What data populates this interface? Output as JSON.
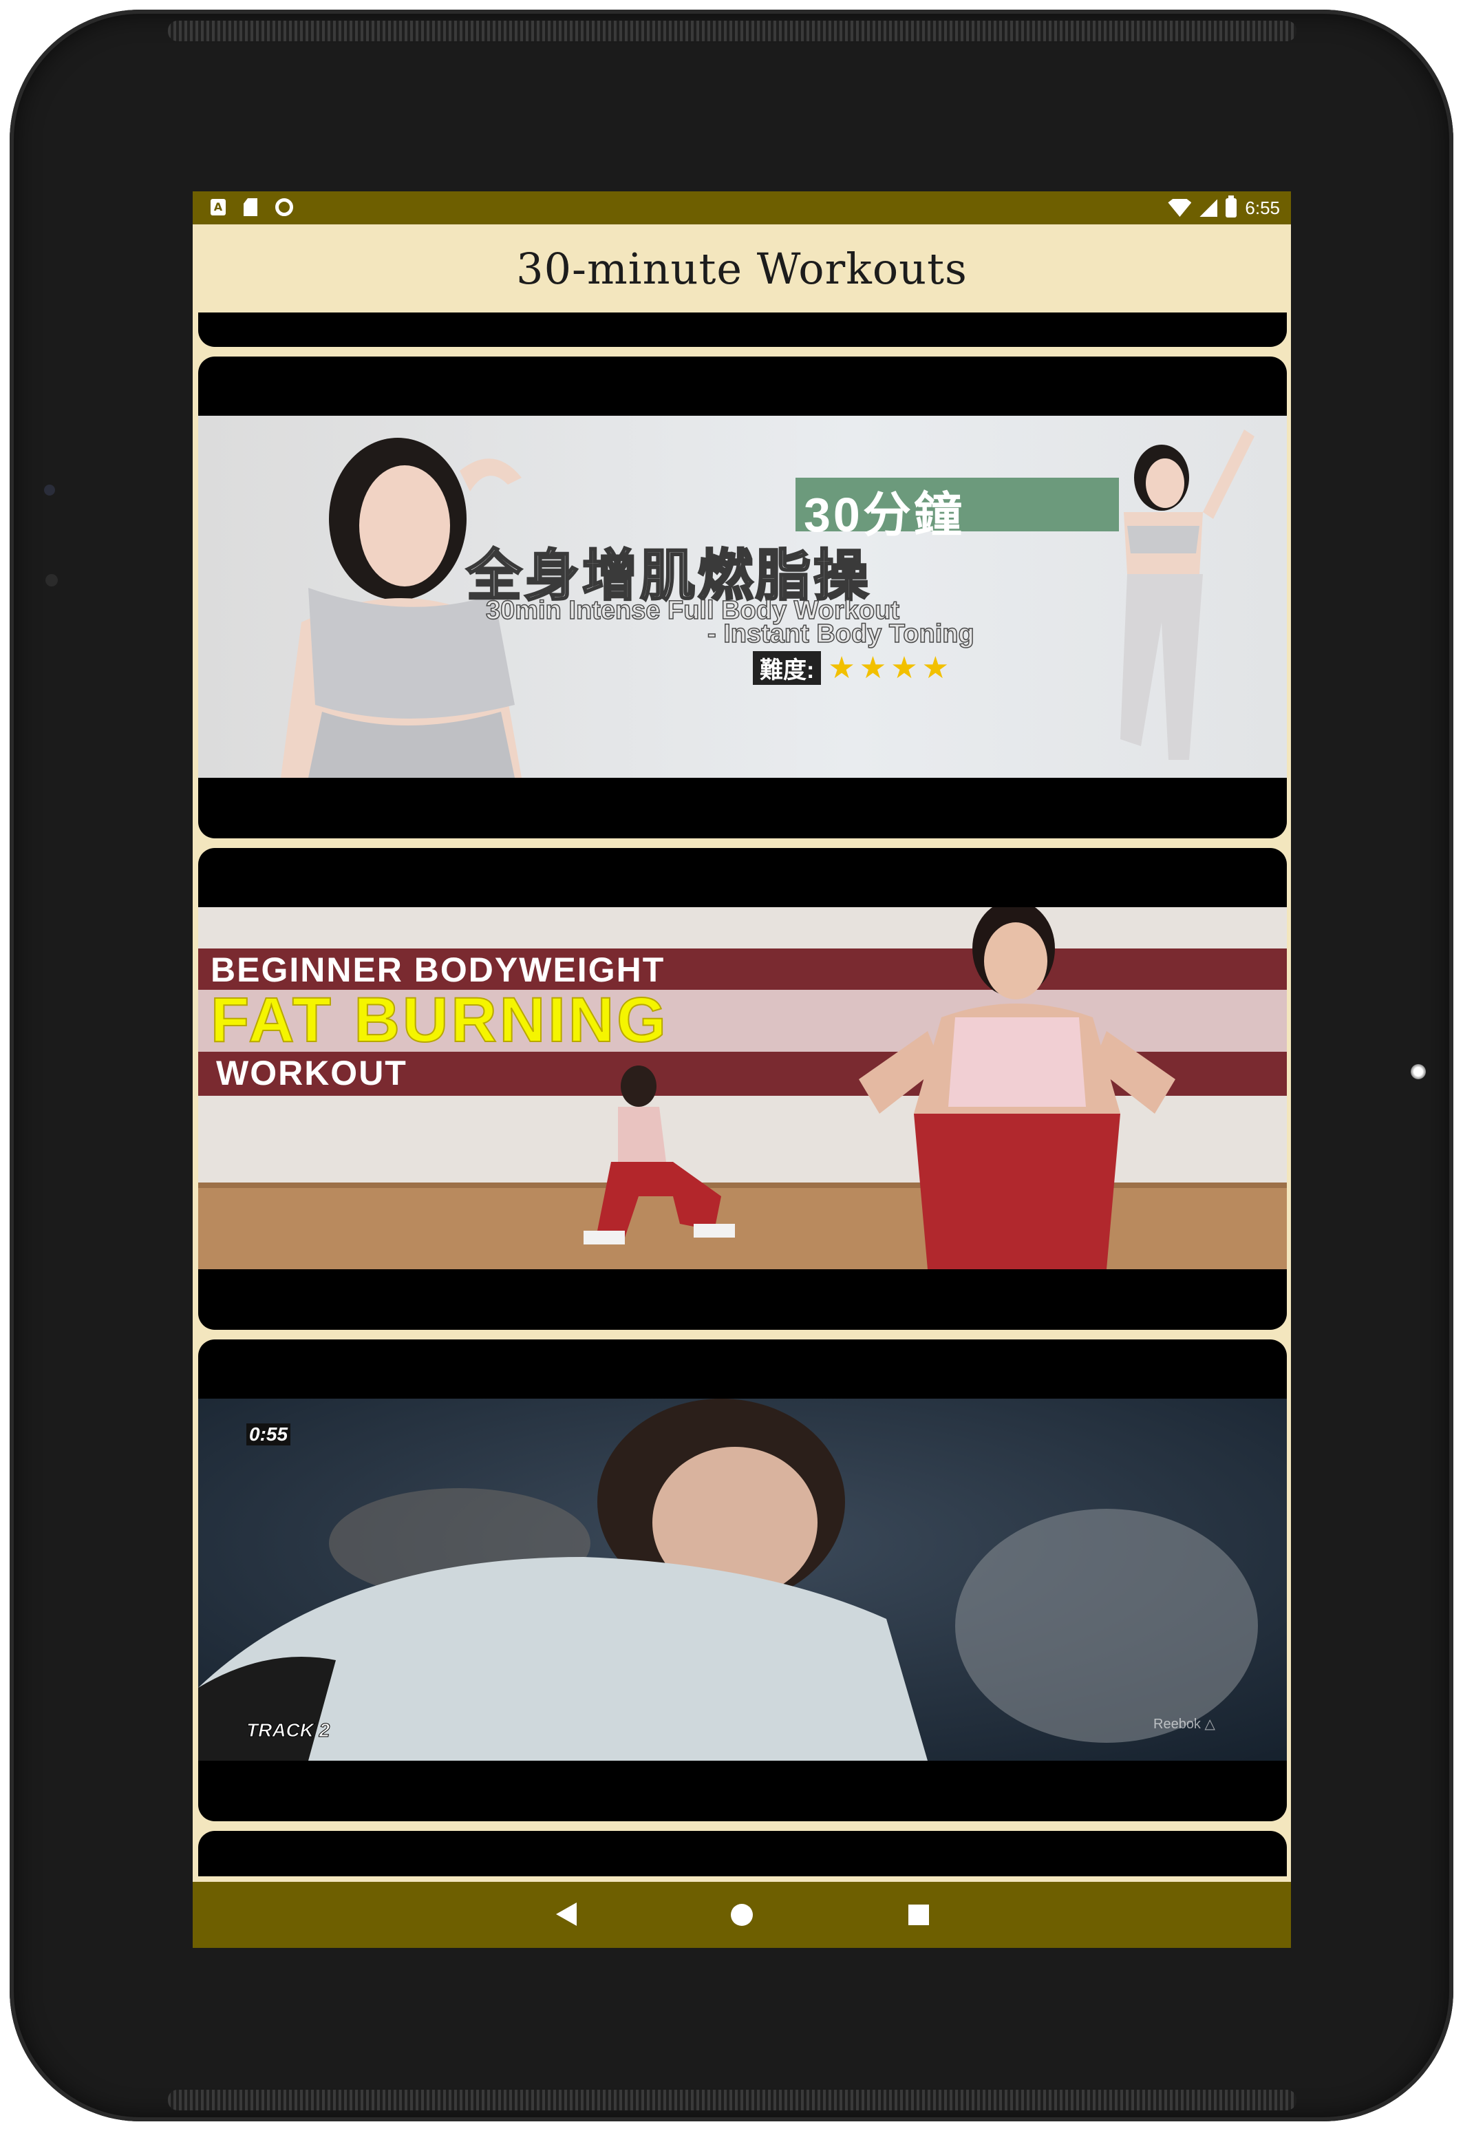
{
  "status_bar": {
    "time": "6:55",
    "left_icons": [
      "a-icon",
      "sd-card-icon",
      "sync-circle-icon"
    ],
    "right_icons": [
      "wifi-icon",
      "signal-icon",
      "battery-icon"
    ]
  },
  "app_bar": {
    "title": "30-minute Workouts"
  },
  "videos": [
    {
      "thumbnail_text": {
        "title_cn": "30分鐘",
        "subtitle_cn": "全身增肌燃脂操",
        "line1": "30min Intense Full Body Workout",
        "line2": "- Instant Body Toning",
        "difficulty_label": "難度:",
        "stars": "★★★★"
      },
      "difficulty_stars": 4
    },
    {
      "thumbnail_text": {
        "line1": "BEGINNER BODYWEIGHT",
        "line2": "FAT BURNING",
        "line3": "WORKOUT"
      }
    },
    {
      "thumbnail_text": {
        "timer": "0:55",
        "track": "TRACK 2",
        "watermark": "Reebok △"
      }
    }
  ],
  "colors": {
    "status_bar": "#6e5f00",
    "app_bar": "#f3e6be",
    "nav_bar": "#6e5f00",
    "card": "#000000",
    "fat_burning_yellow": "#f5f500",
    "banner_red": "#7a2a30"
  },
  "nav_bar": {
    "icons": [
      "back-icon",
      "home-icon",
      "recents-icon"
    ]
  }
}
